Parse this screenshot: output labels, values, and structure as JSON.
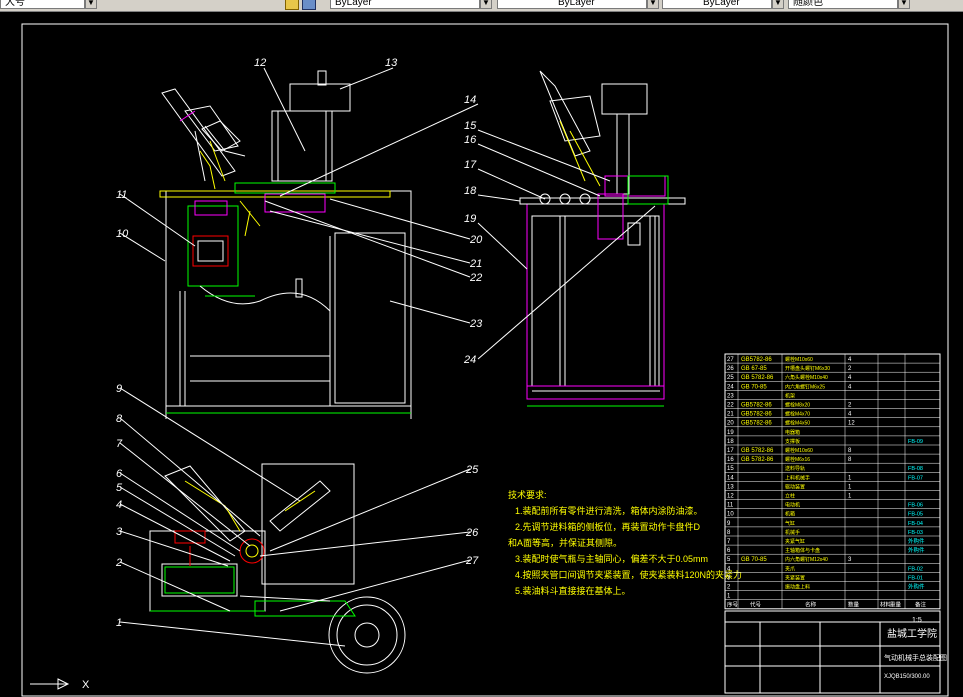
{
  "toolbar": {
    "layer_field": "大号",
    "linetype_field": "ByLayer",
    "lineweight_field": "ByLayer",
    "color_field": "ByLayer",
    "plotstyle_field": "随颜色"
  },
  "drawing": {
    "callouts": [
      "1",
      "2",
      "3",
      "4",
      "5",
      "6",
      "7",
      "8",
      "9",
      "10",
      "11",
      "12",
      "13",
      "14",
      "15",
      "16",
      "17",
      "18",
      "19",
      "20",
      "21",
      "22",
      "23",
      "24",
      "25",
      "26",
      "27"
    ],
    "tech_requirements": {
      "title": "技术要求:",
      "lines": [
        "1.装配前所有零件进行清洗，箱体内涂防油漆。",
        "2.先调节进料箱的侧板位，再装置动作卡盘件D",
        "和A面等高，并保证其侧隙。",
        "3.装配时使气瓶与主轴同心，偏差不大于0.05mm",
        "4.按照夹管口间调节夹紧装置，使夹紧装料120N的夹紧力",
        "5.装油料斗直接接在基体上。"
      ]
    },
    "parts_table": {
      "rows": [
        {
          "no": "27",
          "std": "GB5782-86",
          "name": "螺栓M10x60",
          "qty": "4",
          "note": ""
        },
        {
          "no": "26",
          "std": "GB 67-85",
          "name": "开槽盘头螺钉M6x30",
          "qty": "2",
          "note": ""
        },
        {
          "no": "25",
          "std": "GB 5782-86",
          "name": "六角头螺栓M10x40",
          "qty": "4",
          "note": ""
        },
        {
          "no": "24",
          "std": "GB 70-85",
          "name": "内六角螺钉M6x25",
          "qty": "4",
          "note": ""
        },
        {
          "no": "23",
          "std": "",
          "name": "机架",
          "qty": "",
          "note": ""
        },
        {
          "no": "22",
          "std": "GB5782-86",
          "name": "螺栓M8x20",
          "qty": "2",
          "note": ""
        },
        {
          "no": "21",
          "std": "GB5782-86",
          "name": "螺栓M4x70",
          "qty": "4",
          "note": ""
        },
        {
          "no": "20",
          "std": "GB5782-86",
          "name": "螺栓M4x50",
          "qty": "12",
          "note": ""
        },
        {
          "no": "19",
          "std": "",
          "name": "电器箱",
          "qty": "",
          "note": ""
        },
        {
          "no": "18",
          "std": "",
          "name": "支撑板",
          "qty": "",
          "note": "FB-09"
        },
        {
          "no": "17",
          "std": "GB 5782-86",
          "name": "螺栓M10x60",
          "qty": "8",
          "note": ""
        },
        {
          "no": "16",
          "std": "GB 5782-86",
          "name": "螺栓M6x16",
          "qty": "8",
          "note": ""
        },
        {
          "no": "15",
          "std": "",
          "name": "送料导轨",
          "qty": "",
          "note": "FB-08"
        },
        {
          "no": "14",
          "std": "",
          "name": "上料机械手",
          "qty": "1",
          "note": "FB-07"
        },
        {
          "no": "13",
          "std": "",
          "name": "驱动装置",
          "qty": "1",
          "note": ""
        },
        {
          "no": "12",
          "std": "",
          "name": "立柱",
          "qty": "1",
          "note": ""
        },
        {
          "no": "11",
          "std": "",
          "name": "电动机",
          "qty": "",
          "note": "FB-06"
        },
        {
          "no": "10",
          "std": "",
          "name": "机箱",
          "qty": "",
          "note": "FB-05"
        },
        {
          "no": "9",
          "std": "",
          "name": "气缸",
          "qty": "",
          "note": "FB-04"
        },
        {
          "no": "8",
          "std": "",
          "name": "机械手",
          "qty": "",
          "note": "FB-03"
        },
        {
          "no": "7",
          "std": "",
          "name": "夹紧气缸",
          "qty": "",
          "note": "外购件"
        },
        {
          "no": "6",
          "std": "",
          "name": "主轴箱体与卡盘",
          "qty": "",
          "note": "外购件"
        },
        {
          "no": "5",
          "std": "GB 70-85",
          "name": "内六角螺钉M12x40",
          "qty": "3",
          "note": ""
        },
        {
          "no": "4",
          "std": "",
          "name": "夹爪",
          "qty": "",
          "note": "FB-02"
        },
        {
          "no": "3",
          "std": "",
          "name": "夹紧装置",
          "qty": "",
          "note": "FB-01"
        },
        {
          "no": "2",
          "std": "",
          "name": "振动盘上料",
          "qty": "",
          "note": "外购件"
        },
        {
          "no": "1",
          "std": "",
          "name": "",
          "qty": "",
          "note": ""
        }
      ],
      "header": {
        "no": "序号",
        "std": "代号",
        "name": "名称",
        "qty": "数量",
        "material": "材料",
        "weight": "重量",
        "note": "备注"
      },
      "school": "盐城工学院",
      "drawing_title": "气动机械手总装配图",
      "drawing_no": "XJQB150/300.00",
      "scale": "1:5"
    }
  },
  "colors": {
    "background": "#000000",
    "yellow": "#ffff00",
    "white": "#ffffff",
    "green": "#00ff00",
    "magenta": "#ff00ff",
    "red": "#ff0000",
    "cyan": "#00ffff"
  }
}
